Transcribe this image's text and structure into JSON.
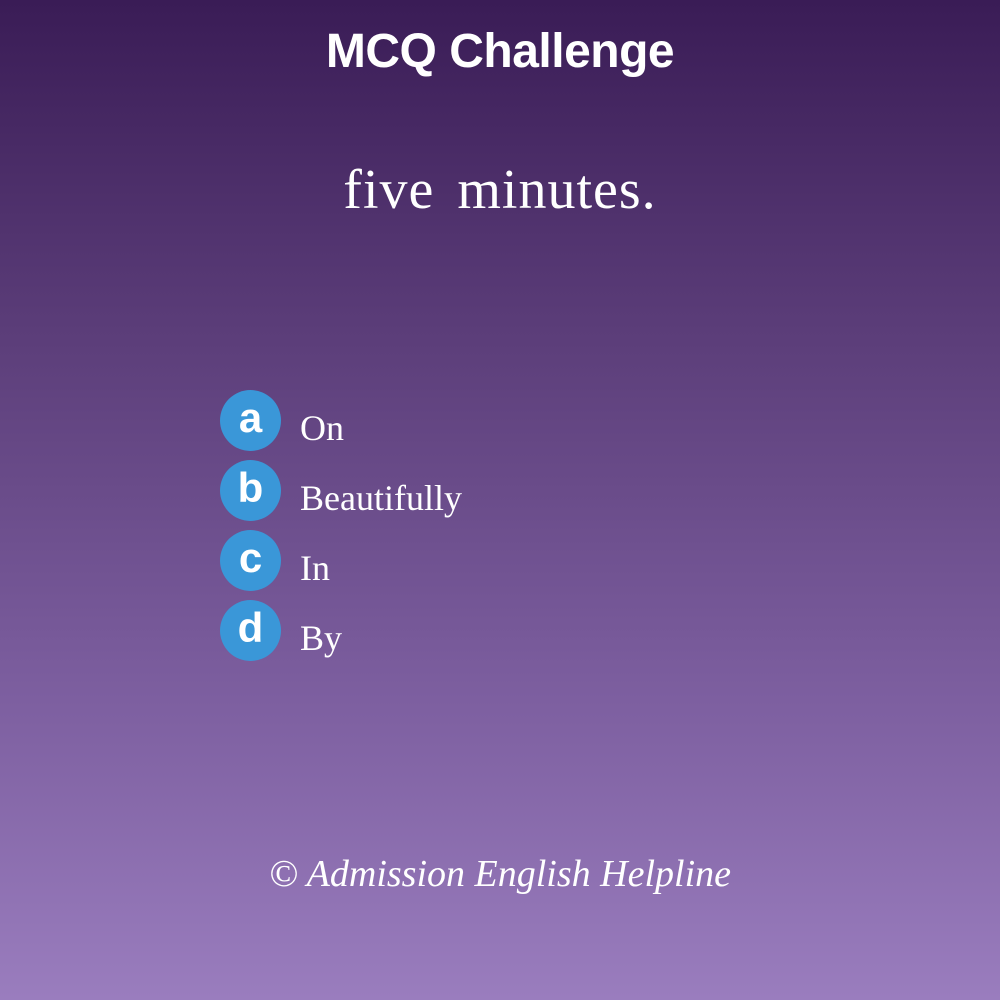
{
  "title": "MCQ Challenge",
  "question": "five minutes.",
  "options": [
    {
      "letter": "a",
      "text": "On"
    },
    {
      "letter": "b",
      "text": "Beautifully"
    },
    {
      "letter": "c",
      "text": "In"
    },
    {
      "letter": "d",
      "text": "By"
    }
  ],
  "footer": "© Admission English Helpline",
  "colors": {
    "badge": "#3a97d8",
    "background_top": "#3a1c56",
    "background_bottom": "#9a7dbe",
    "text": "#ffffff"
  }
}
